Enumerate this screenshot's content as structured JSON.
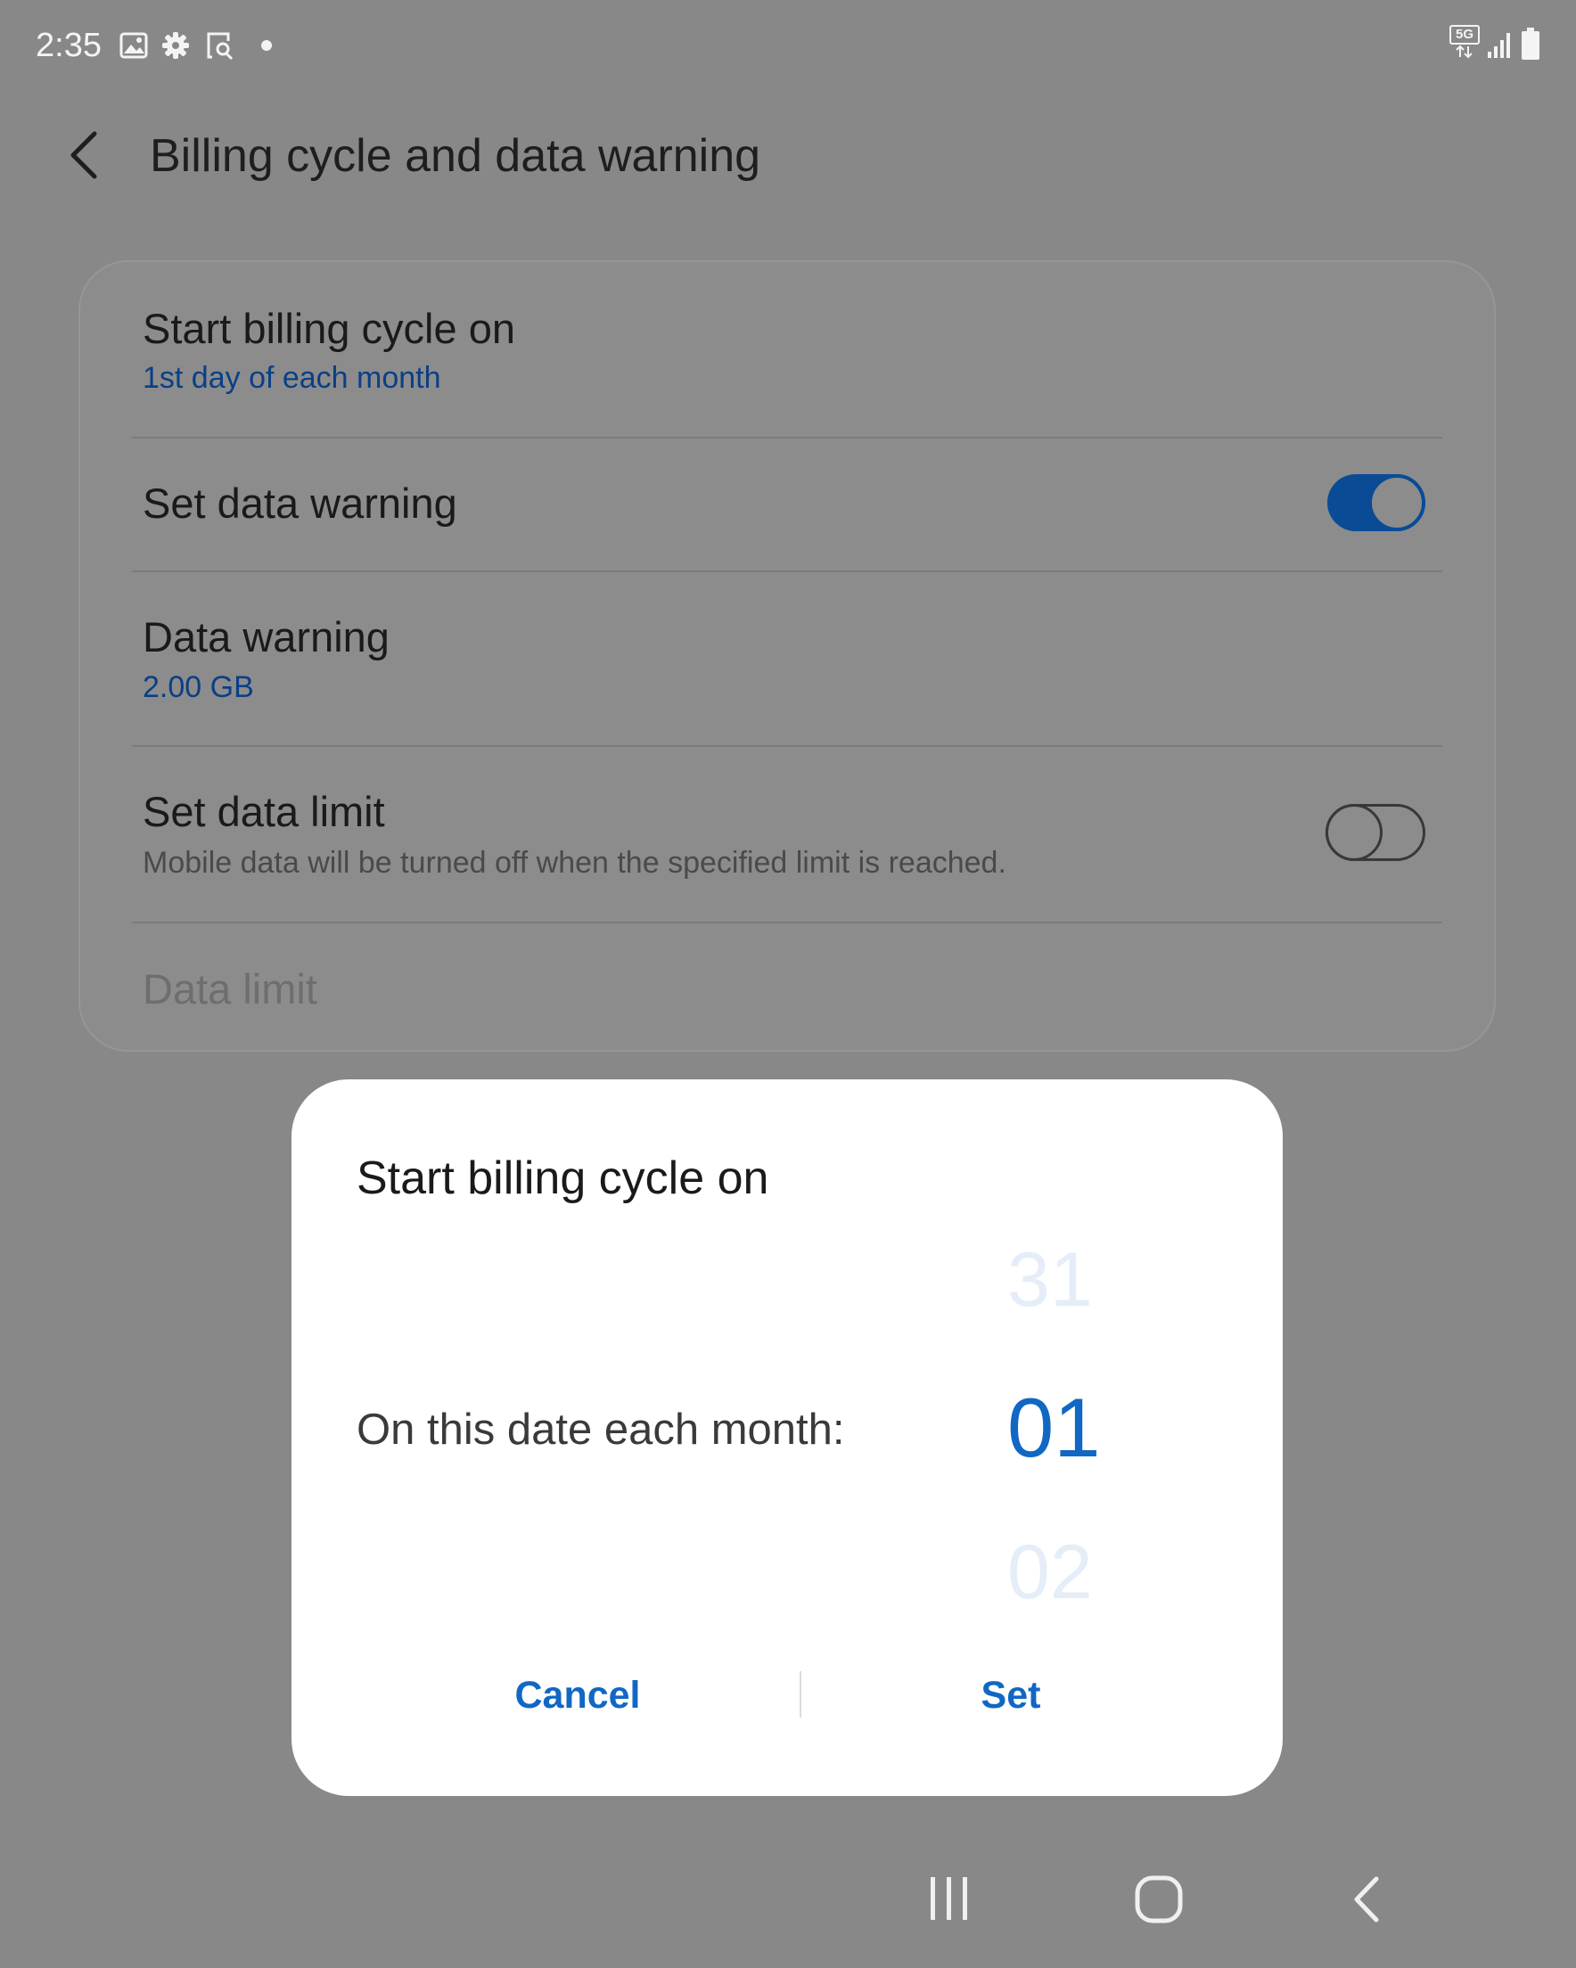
{
  "status_bar": {
    "time": "2:35",
    "network": "5G",
    "icons": [
      "gallery-icon",
      "settings-gear-icon",
      "screen-recorder-icon",
      "notification-dot-icon",
      "signal-icon",
      "battery-icon"
    ]
  },
  "header": {
    "title": "Billing cycle and data warning",
    "back_icon": "chevron-left-icon"
  },
  "settings": {
    "billing_cycle": {
      "title": "Start billing cycle on",
      "value": "1st day of each month"
    },
    "set_data_warning": {
      "title": "Set data warning",
      "enabled": true
    },
    "data_warning": {
      "title": "Data warning",
      "value": "2.00 GB"
    },
    "set_data_limit": {
      "title": "Set data limit",
      "description": "Mobile data will be turned off when the specified limit is reached.",
      "enabled": false
    },
    "data_limit": {
      "title": "Data limit"
    }
  },
  "dialog": {
    "title": "Start billing cycle on",
    "label": "On this date each month:",
    "picker": {
      "previous": "31",
      "selected": "01",
      "next": "02"
    },
    "cancel_label": "Cancel",
    "set_label": "Set"
  },
  "navigation_bar": {
    "icons": [
      "recent-apps-icon",
      "home-icon",
      "back-icon"
    ]
  },
  "colors": {
    "accent": "#1167c4",
    "dim_overlay_bg": "#888888",
    "toggle_on": "#0a4b96",
    "dialog_bg": "#ffffff"
  }
}
